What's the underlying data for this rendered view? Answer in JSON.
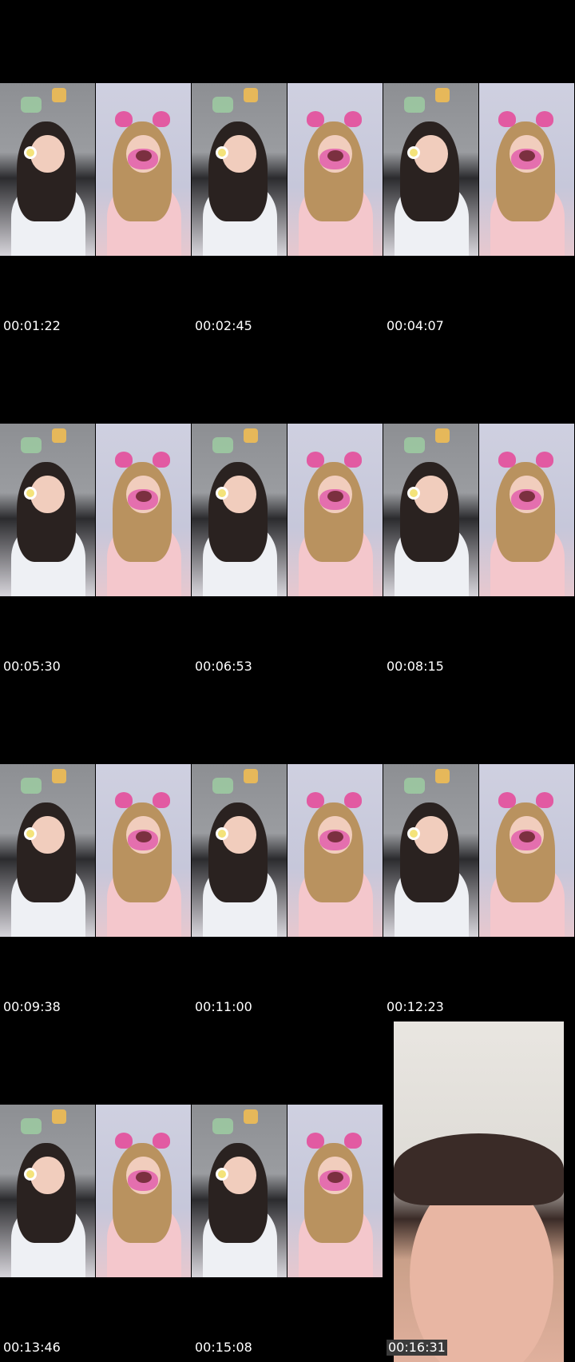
{
  "timestamps": [
    "00:01:22",
    "00:02:45",
    "00:04:07",
    "00:05:30",
    "00:06:53",
    "00:08:15",
    "00:09:38",
    "00:11:00",
    "00:12:23",
    "00:13:46",
    "00:15:08",
    "00:16:31"
  ]
}
